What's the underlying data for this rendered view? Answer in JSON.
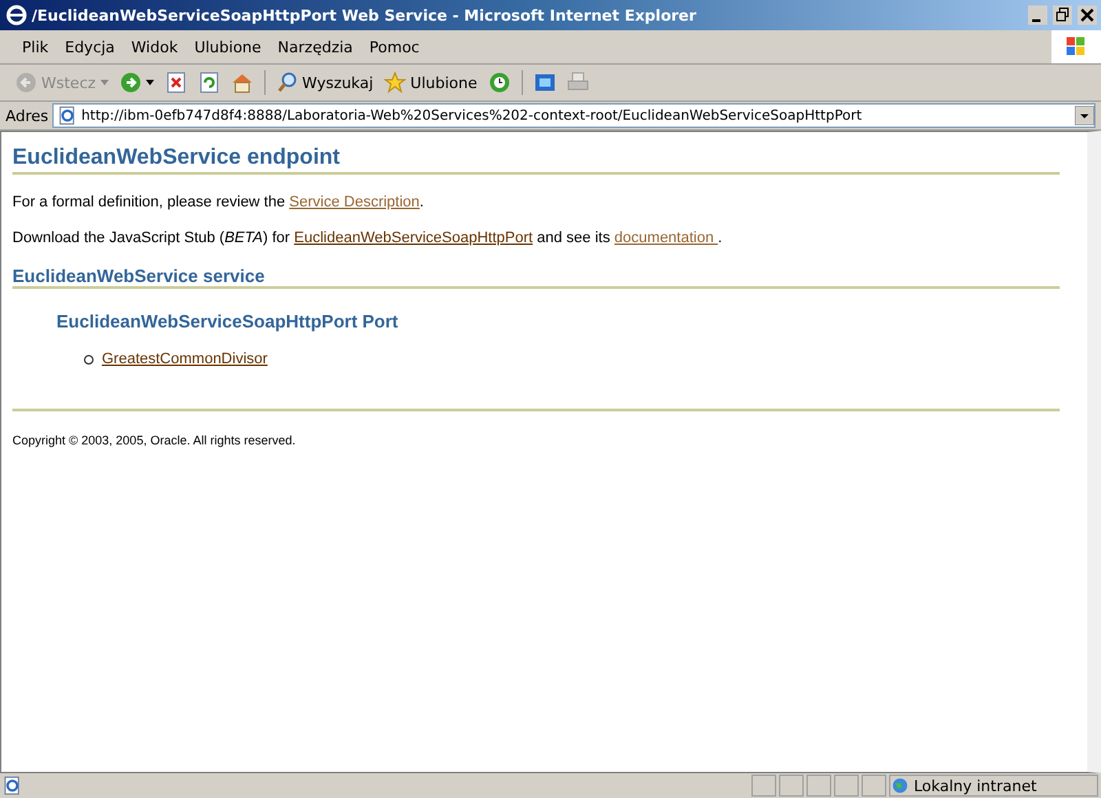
{
  "window": {
    "title": "/EuclideanWebServiceSoapHttpPort Web Service - Microsoft Internet Explorer"
  },
  "menu": [
    "Plik",
    "Edycja",
    "Widok",
    "Ulubione",
    "Narzędzia",
    "Pomoc"
  ],
  "toolbar": [
    {
      "kind": "back",
      "label": "Wstecz",
      "disabled": true
    },
    {
      "kind": "forward",
      "disabled": false
    },
    {
      "kind": "stop",
      "disabled": false
    },
    {
      "kind": "refresh",
      "disabled": false
    },
    {
      "kind": "home",
      "disabled": false
    },
    {
      "kind": "search",
      "label": "Wyszukaj",
      "disabled": false
    },
    {
      "kind": "favorites",
      "label": "Ulubione",
      "disabled": false
    },
    {
      "kind": "history",
      "disabled": false
    },
    {
      "kind": "mail",
      "disabled": false
    },
    {
      "kind": "print",
      "disabled": true
    }
  ],
  "address": {
    "label": "Adres",
    "value": "http://ibm-0efb747d8f4:8888/Laboratoria-Web%20Services%202-context-root/EuclideanWebServiceSoapHttpPort"
  },
  "page": {
    "heading": "EuclideanWebService endpoint",
    "para1": {
      "before": "For a formal definition, please review the ",
      "link": "Service Description",
      "after": "."
    },
    "para2": {
      "before": "Download the JavaScript Stub (*BETA*) for ",
      "link1": "EuclideanWebServiceSoapHttpPort",
      "middle": " and see its ",
      "link2": "documentation ",
      "after": "."
    },
    "service_heading": "EuclideanWebService service",
    "port_heading": "EuclideanWebServiceSoapHttpPort Port",
    "operations": [
      "GreatestCommonDivisor"
    ],
    "copyright": "Copyright © 2003, 2005, Oracle. All rights reserved."
  },
  "status_bar": {
    "zone": "Lokalny intranet"
  }
}
